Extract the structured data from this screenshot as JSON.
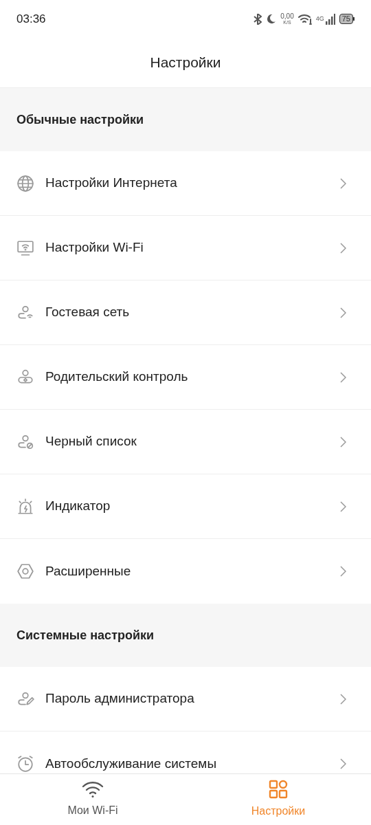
{
  "status_bar": {
    "time": "03:36",
    "speed": "0,00",
    "speed_unit": "K/S",
    "network": "4G",
    "battery": "75"
  },
  "header": {
    "title": "Настройки"
  },
  "sections": [
    {
      "title": "Обычные настройки",
      "items": [
        {
          "label": "Настройки Интернета",
          "kind": "globe"
        },
        {
          "label": "Настройки Wi-Fi",
          "kind": "monitor"
        },
        {
          "label": "Гостевая сеть",
          "kind": "guest"
        },
        {
          "label": "Родительский контроль",
          "kind": "parent"
        },
        {
          "label": "Черный список",
          "kind": "block"
        },
        {
          "label": "Индикатор",
          "kind": "light"
        },
        {
          "label": "Расширенные",
          "kind": "nut"
        }
      ]
    },
    {
      "title": "Системные настройки",
      "items": [
        {
          "label": "Пароль администратора",
          "kind": "pen"
        },
        {
          "label": "Автообслуживание системы",
          "kind": "clock"
        }
      ]
    }
  ],
  "tabs": [
    {
      "label": "Мои Wi-Fi",
      "kind": "wifi",
      "selected": false
    },
    {
      "label": "Настройки",
      "kind": "grid",
      "selected": true
    }
  ]
}
